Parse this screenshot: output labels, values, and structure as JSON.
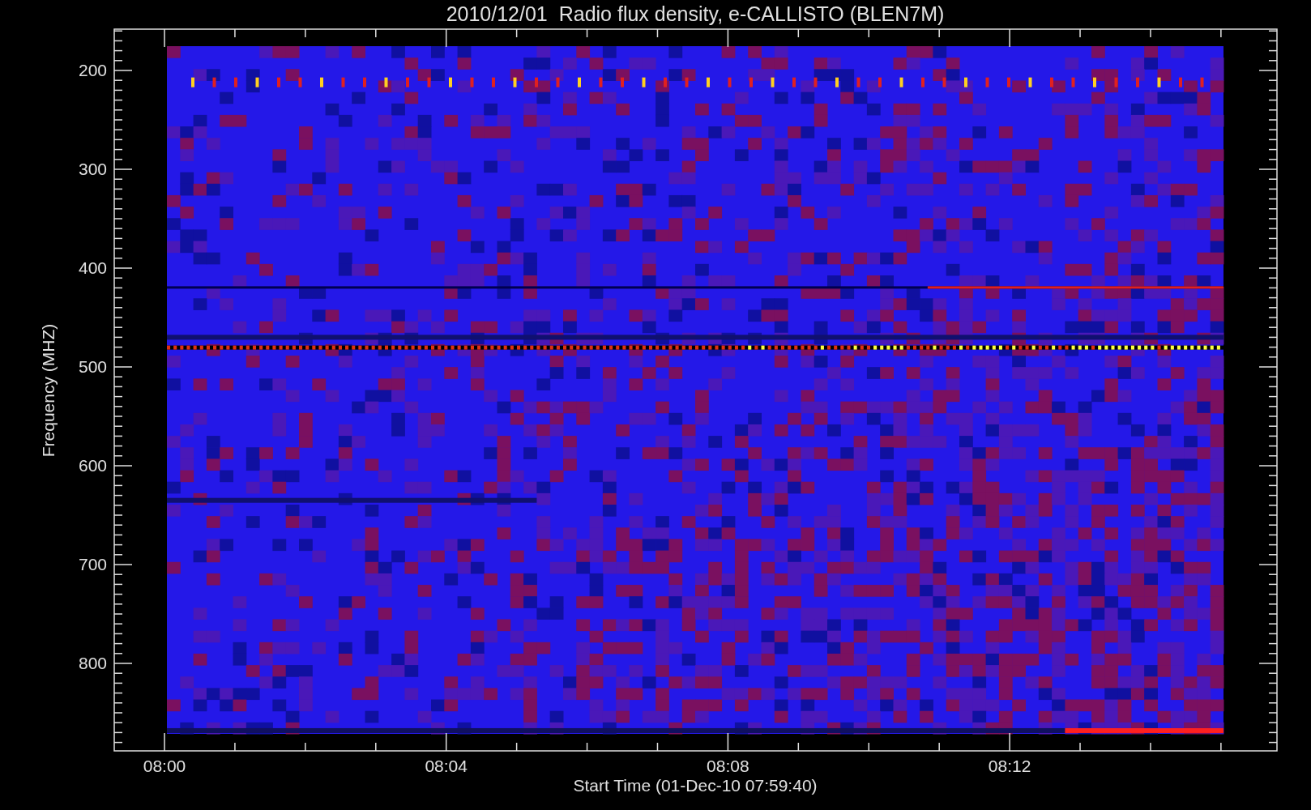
{
  "title": "2010/12/01  Radio flux density, e-CALLISTO (BLEN7M)",
  "y_axis": {
    "label": "Frequency (MHZ)",
    "ticks": [
      "200",
      "300",
      "400",
      "500",
      "600",
      "700",
      "800"
    ]
  },
  "x_axis": {
    "label": "Start Time (01-Dec-10 07:59:40)",
    "ticks": [
      "08:00",
      "08:04",
      "08:08",
      "08:12"
    ]
  }
}
